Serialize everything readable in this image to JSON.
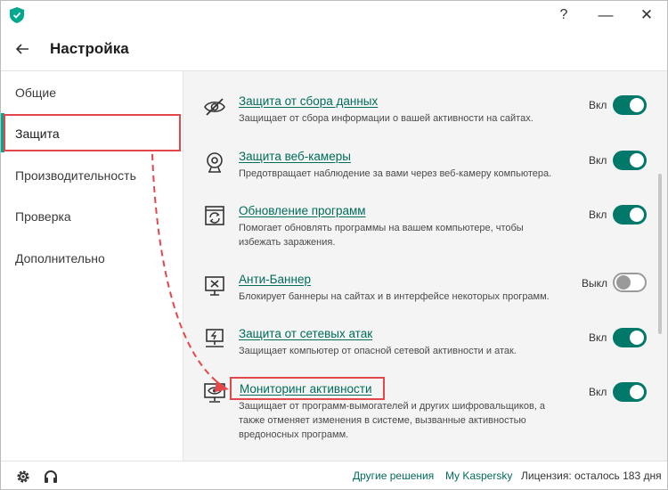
{
  "window": {
    "help_label": "?",
    "minimize_label": "—",
    "close_label": "✕"
  },
  "header": {
    "title": "Настройка"
  },
  "sidebar": {
    "items": [
      {
        "label": "Общие"
      },
      {
        "label": "Защита"
      },
      {
        "label": "Производительность"
      },
      {
        "label": "Проверка"
      },
      {
        "label": "Дополнительно"
      }
    ],
    "active_index": 1
  },
  "content": {
    "rows": [
      {
        "icon": "eye-crossed-icon",
        "title": "Защита от сбора данных",
        "desc": [
          "Защищает от сбора информации о вашей активности на сайтах."
        ],
        "state": "Вкл",
        "on": true
      },
      {
        "icon": "webcam-icon",
        "title": "Защита веб-камеры",
        "desc": [
          "Предотвращает наблюдение за вами через веб-камеру компьютера."
        ],
        "state": "Вкл",
        "on": true
      },
      {
        "icon": "update-icon",
        "title": "Обновление программ",
        "desc": [
          "Помогает обновлять программы на вашем компьютере, чтобы",
          "избежать заражения."
        ],
        "state": "Вкл",
        "on": true
      },
      {
        "icon": "banner-blocked-icon",
        "title": "Анти-Баннер",
        "desc": [
          "Блокирует баннеры на сайтах и в интерфейсе некоторых программ."
        ],
        "state": "Выкл",
        "on": false
      },
      {
        "icon": "network-attack-icon",
        "title": "Защита от сетевых атак",
        "desc": [
          "Защищает компьютер от опасной сетевой активности и атак."
        ],
        "state": "Вкл",
        "on": true
      },
      {
        "icon": "activity-monitor-icon",
        "title": "Мониторинг активности",
        "desc": [
          "Защищает от программ-вымогателей и других шифровальщиков, а",
          "также отменяет изменения в системе, вызванные активностью",
          "вредоносных программ."
        ],
        "state": "Вкл",
        "on": true
      }
    ]
  },
  "footer": {
    "other_solutions": "Другие решения",
    "my_kaspersky": "My Kaspersky",
    "license": "Лицензия: осталось 183 дня"
  },
  "colors": {
    "accent": "#00796b",
    "link": "#006d5b",
    "highlight": "#e4474a"
  }
}
